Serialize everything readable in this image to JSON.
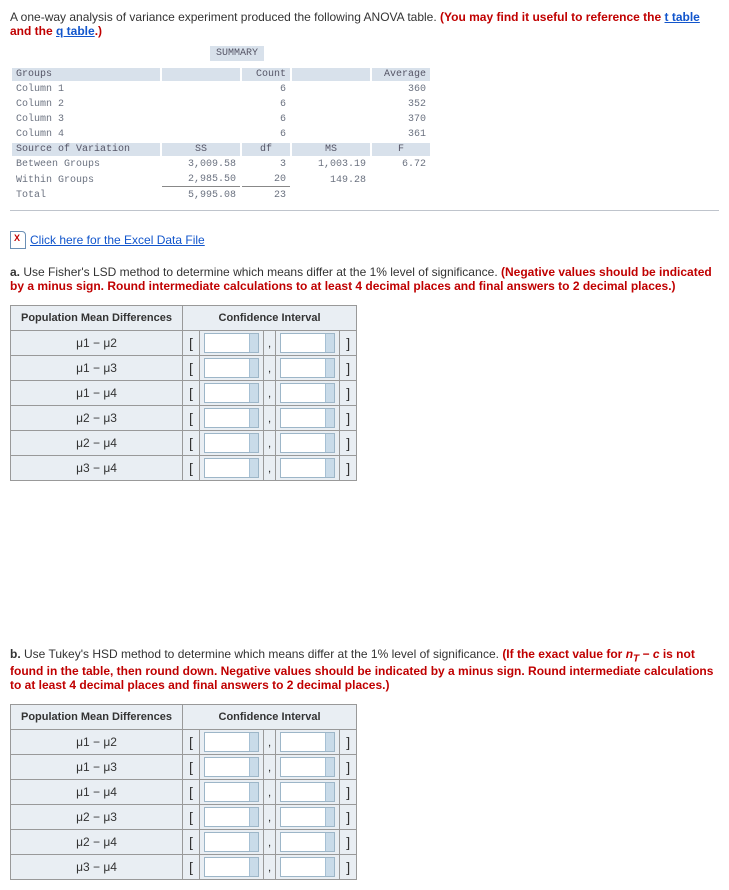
{
  "intro": {
    "lead": "A one-way analysis of variance experiment produced the following ANOVA table.",
    "you_may": " (You may find it useful to reference the ",
    "t_link": "t table",
    "and": " and the ",
    "q_link": "q table",
    "close": ".)"
  },
  "summary": {
    "label": "SUMMARY",
    "hdr_groups": "Groups",
    "hdr_count": "Count",
    "hdr_avg": "Average",
    "rows": [
      {
        "name": "Column 1",
        "count": "6",
        "avg": "360"
      },
      {
        "name": "Column 2",
        "count": "6",
        "avg": "352"
      },
      {
        "name": "Column 3",
        "count": "6",
        "avg": "370"
      },
      {
        "name": "Column 4",
        "count": "6",
        "avg": "361"
      }
    ]
  },
  "anova": {
    "hdr_source": "Source of Variation",
    "hdr_ss": "SS",
    "hdr_df": "df",
    "hdr_ms": "MS",
    "hdr_f": "F",
    "between": {
      "name": "Between Groups",
      "ss": "3,009.58",
      "df": "3",
      "ms": "1,003.19",
      "f": "6.72"
    },
    "within": {
      "name": "Within Groups",
      "ss": "2,985.50",
      "df": "20",
      "ms": "149.28",
      "f": ""
    },
    "total": {
      "name": "Total",
      "ss": "5,995.08",
      "df": "23",
      "ms": "",
      "f": ""
    }
  },
  "excel_link": "Click here for the Excel Data File",
  "partA": {
    "lead": "a.",
    "text": " Use Fisher's LSD method to determine which means differ at the 1% level of significance. ",
    "red": "(Negative values should be indicated by a minus sign. Round intermediate calculations to at least 4 decimal places and final answers to 2 decimal places.)"
  },
  "partB": {
    "lead": "b.",
    "text": " Use Tukey's HSD method to determine which means differ at the 1% level of significance. ",
    "red": "(If the exact value for n_T − c is not found in the table, then round down. Negative values should be indicated by a minus sign. Round intermediate calculations to at least 4 decimal places and final answers to 2 decimal places.)",
    "nt_c": "n_T − c"
  },
  "table_headers": {
    "pmd": "Population Mean Differences",
    "ci": "Confidence Interval"
  },
  "diffs": [
    "μ1 − μ2",
    "μ1 − μ3",
    "μ1 − μ4",
    "μ2 − μ3",
    "μ2 − μ4",
    "μ3 − μ4"
  ]
}
